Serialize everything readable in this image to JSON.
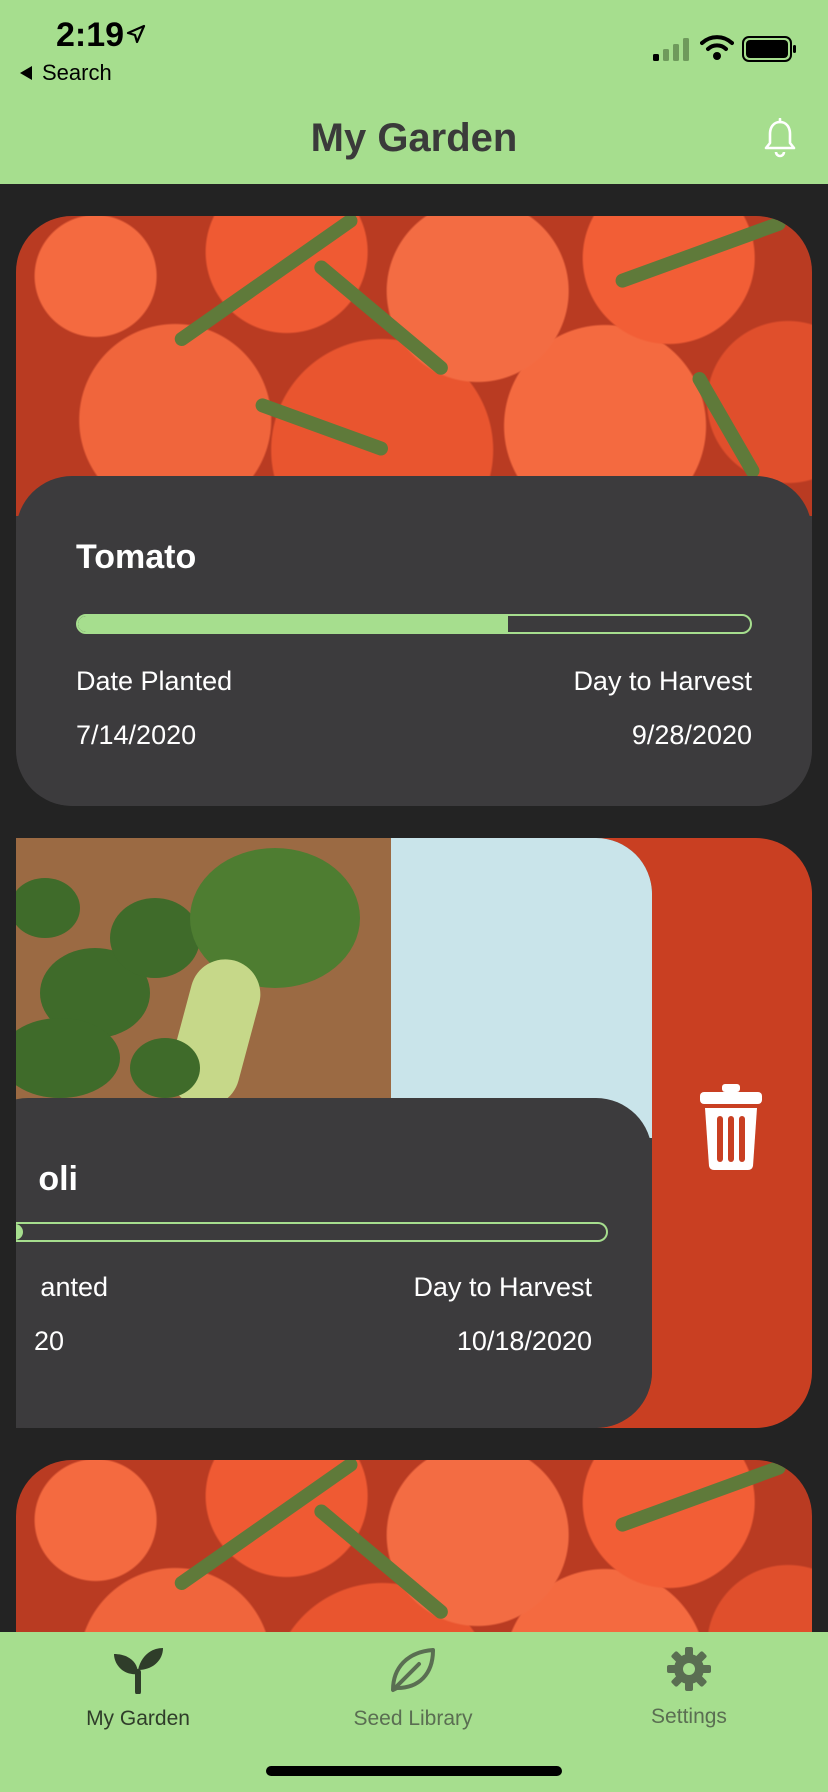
{
  "status_bar": {
    "time": "2:19",
    "back_label": "Search"
  },
  "header": {
    "title": "My Garden"
  },
  "plants": [
    {
      "name": "Tomato",
      "progress": 0.64,
      "date_planted_label": "Date Planted",
      "date_planted": "7/14/2020",
      "harvest_label": "Day to Harvest",
      "harvest_date": "9/28/2020"
    },
    {
      "name": "oli",
      "progress": 0.08,
      "date_planted_label": "anted",
      "date_planted": "20",
      "harvest_label": "Day to Harvest",
      "harvest_date": "10/18/2020"
    }
  ],
  "tabs": [
    {
      "label": "My Garden",
      "icon": "sprout-icon",
      "active": true
    },
    {
      "label": "Seed Library",
      "icon": "leaf-icon",
      "active": false
    },
    {
      "label": "Settings",
      "icon": "gear-icon",
      "active": false
    }
  ],
  "colors": {
    "accent": "#a6de8e",
    "background": "#232323",
    "card": "#3c3b3d",
    "delete": "#c93f22"
  }
}
